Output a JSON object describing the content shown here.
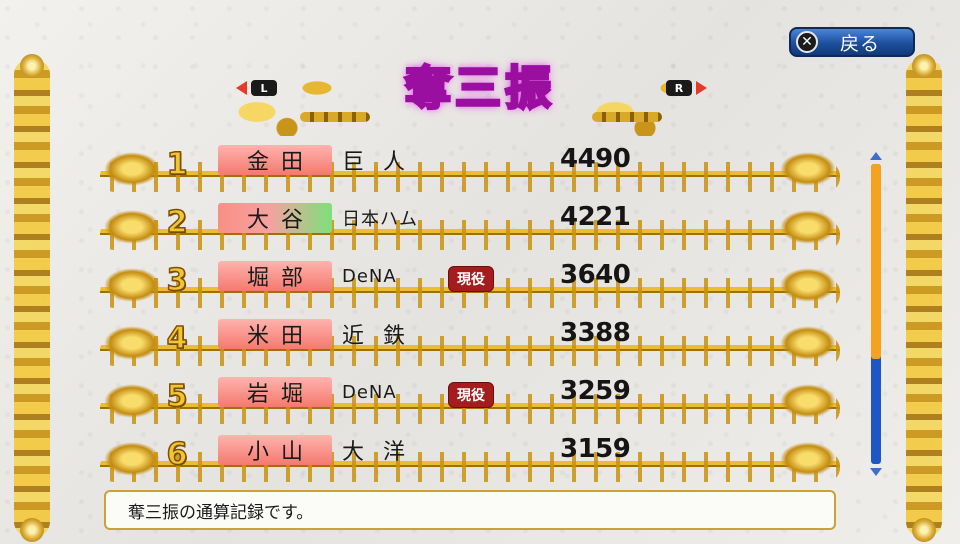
{
  "header": {
    "title": "奪三振",
    "back_label": "戻る",
    "back_key_icon": "x-button-icon",
    "l_key": "L",
    "r_key": "R"
  },
  "rankings": [
    {
      "rank": "1",
      "name": "金田",
      "team": "巨 人",
      "value": "4490",
      "active": false,
      "highlight": "red"
    },
    {
      "rank": "2",
      "name": "大谷",
      "team": "日本ハム",
      "value": "4221",
      "active": false,
      "highlight": "red-green"
    },
    {
      "rank": "3",
      "name": "堀部",
      "team": "DeNA",
      "value": "3640",
      "active": true,
      "highlight": "red"
    },
    {
      "rank": "4",
      "name": "米田",
      "team": "近 鉄",
      "value": "3388",
      "active": false,
      "highlight": "red"
    },
    {
      "rank": "5",
      "name": "岩堀",
      "team": "DeNA",
      "value": "3259",
      "active": true,
      "highlight": "red"
    },
    {
      "rank": "6",
      "name": "小山",
      "team": "大 洋",
      "value": "3159",
      "active": false,
      "highlight": "red"
    }
  ],
  "active_badge": "現役",
  "scrollbar": {
    "position_fraction": 0.0,
    "visible_fraction": 0.65
  },
  "message": "奪三振の通算記録です。",
  "colors": {
    "title_glow": "#9a0ea0",
    "gold": "#e9bd36",
    "name_box": "#f4796f",
    "badge": "#a41c1c",
    "button_blue": "#1c4f9c",
    "scroll_track": "#1e56c6",
    "scroll_thumb": "#f4a21f"
  }
}
